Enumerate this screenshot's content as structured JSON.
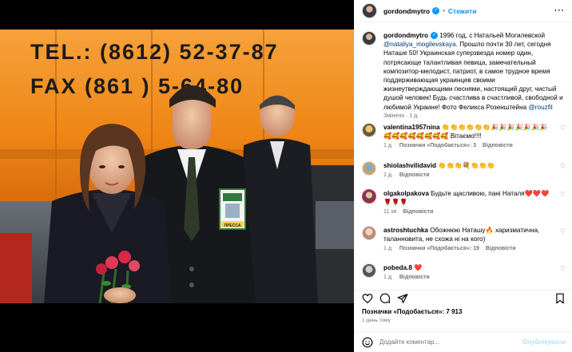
{
  "header": {
    "username": "gordondmytro",
    "follow_label": "Стежити"
  },
  "caption": {
    "username": "gordondmytro",
    "text_before": " 1996 год, с Натальей Могилевской ",
    "mention_1": "@nataliya_mogilevskaya",
    "text_middle": ". Прошло почти 30 лет, сегодня Наташе 50! Украинская суперзвезда номер один, потрясающе талантливая певица, замечательный композитор-мелодист, патриот, в самое трудное время поддерживающая украинцев своими жизнеутверждающими песнями, настоящий друг, чистый душой человек! Будь счастлива в счастливой, свободной и любимой Украине! Фото Феликса Розенштейна ",
    "mention_2": "@rouzfil",
    "meta": "Змінено · 1 д."
  },
  "comments": [
    {
      "username": "valentina1957nina",
      "text": " 👏👏👏👏👏👏🎉🎉🎉🎉🎉🎉🎉🥰🥰🥰🥰🥰🥰🥰🥰 Вітаємо!!!!",
      "time": "1 д.",
      "likes": "Позначки «Подобається»: 3",
      "reply": "Відповісти"
    },
    {
      "username": "shiolashvilidavid",
      "text": " 👏👏👏💐👏👏👏",
      "time": "1 д.",
      "likes": "",
      "reply": "Відповісти"
    },
    {
      "username": "olgakolpakova",
      "text": " Будьте щасливою, пані Наталя❤️❤️❤️🌹🌹🌹",
      "time": "11 хв",
      "likes": "",
      "reply": "Відповісти"
    },
    {
      "username": "astroshtuchka",
      "text": " Обожнюю Наташу🔥 харизматична, таланновита, не схожа ні на кого)",
      "time": "1 д.",
      "likes": "Позначки «Подобається»: 19",
      "reply": "Відповісти"
    },
    {
      "username": "pobeda.8",
      "text": " ❤️",
      "time": "1 д.",
      "likes": "",
      "reply": "Відповісти"
    }
  ],
  "footer": {
    "likes_label": "Позначки «Подобається»: 7 913",
    "time": "1 день тому",
    "comment_placeholder": "Додайте коментар...",
    "publish_label": "Опублікувати"
  },
  "photo": {
    "sign_line_1": "TEL.: (8612) 52-37-87",
    "sign_line_2": "FAX (861 ) 5-64-80",
    "badge_text": "ПРЕССА"
  },
  "colors": {
    "accent": "#0095f6",
    "link": "#00376b",
    "muted": "#737373",
    "sign_orange": "#f08a1c"
  }
}
